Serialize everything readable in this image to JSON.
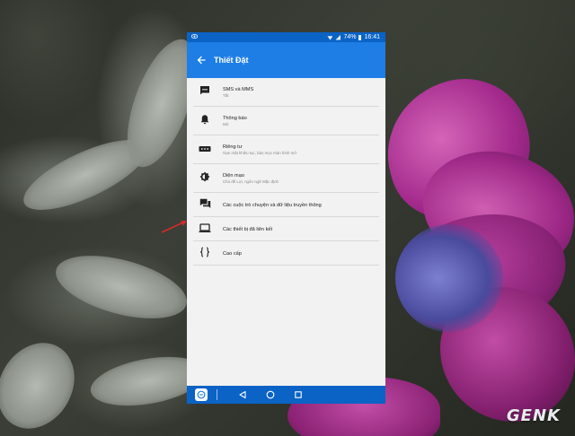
{
  "status_bar": {
    "battery_percent": "74%",
    "time": "16:41"
  },
  "app_bar": {
    "title": "Thiết Đặt"
  },
  "settings_items": [
    {
      "title": "SMS và MMS",
      "subtitle": "Tắt",
      "icon": "message-dots-icon"
    },
    {
      "title": "Thông báo",
      "subtitle": "Mở",
      "icon": "bell-icon"
    },
    {
      "title": "Riêng tư",
      "subtitle": "Gạn mặt khiêu tục, báo mọc màn hình mờ",
      "icon": "password-dots-icon"
    },
    {
      "title": "Diện mạo",
      "subtitle": "Chủ đề Lợi, ngôn ngữ Mặc định",
      "icon": "brightness-icon"
    },
    {
      "title": "Các cuộc trò chuyện và dữ liệu truyền thông",
      "subtitle": "",
      "icon": "chat-bubbles-icon"
    },
    {
      "title": "Các thiết bị đã liên kết",
      "subtitle": "",
      "icon": "laptop-icon"
    },
    {
      "title": "Cao cấp",
      "subtitle": "",
      "icon": "braces-icon"
    }
  ],
  "nav_bar": {
    "back_icon": "nav-back-icon",
    "home_icon": "nav-home-icon",
    "recents_icon": "nav-recents-icon"
  },
  "watermark": {
    "text": "GENK"
  },
  "colors": {
    "status_bar": "#0b63c6",
    "app_bar": "#1e7ee6",
    "list_bg": "#f2f2f2",
    "annotation_arrow": "#d62a2a"
  }
}
